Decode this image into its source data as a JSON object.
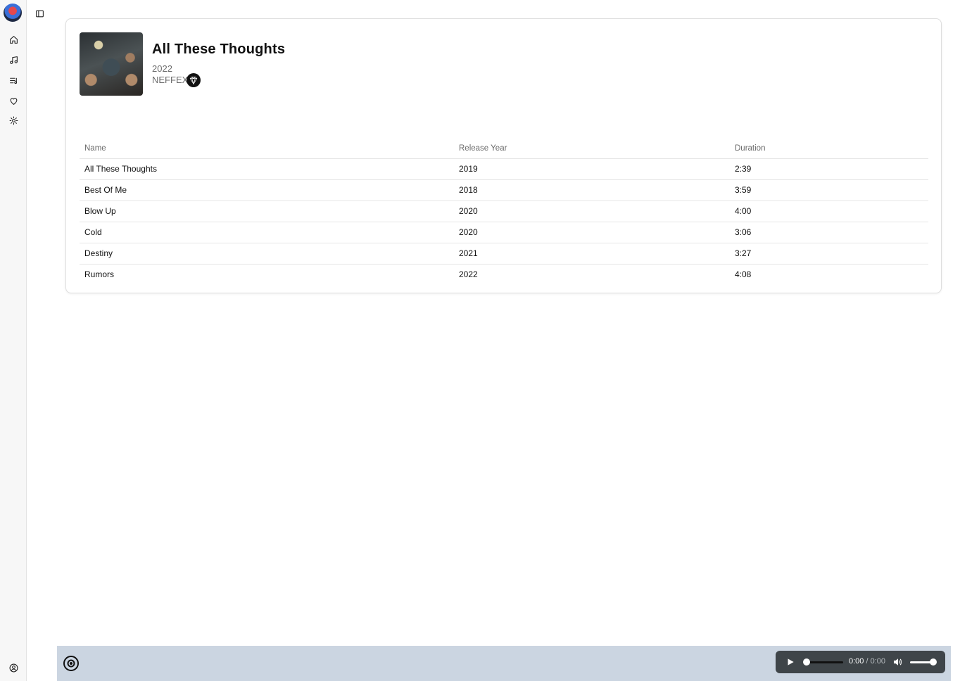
{
  "sidebar": {
    "items": [
      {
        "name": "home",
        "icon": "home-icon"
      },
      {
        "name": "songs",
        "icon": "music-note-icon"
      },
      {
        "name": "playlists",
        "icon": "playlist-icon"
      },
      {
        "name": "favorites",
        "icon": "heart-icon"
      },
      {
        "name": "settings",
        "icon": "gear-icon"
      }
    ],
    "footer_icon": "user-circle-icon"
  },
  "album": {
    "title": "All These Thoughts",
    "year": "2022",
    "artist": "NEFFEX"
  },
  "table": {
    "headers": [
      "Name",
      "Release Year",
      "Duration"
    ],
    "rows": [
      {
        "name": "All These Thoughts",
        "year": "2019",
        "duration": "2:39"
      },
      {
        "name": "Best Of Me",
        "year": "2018",
        "duration": "3:59"
      },
      {
        "name": "Blow Up",
        "year": "2020",
        "duration": "4:00"
      },
      {
        "name": "Cold",
        "year": "2020",
        "duration": "3:06"
      },
      {
        "name": "Destiny",
        "year": "2021",
        "duration": "3:27"
      },
      {
        "name": "Rumors",
        "year": "2022",
        "duration": "4:08"
      }
    ]
  },
  "player": {
    "current_time": "0:00",
    "separator": "/",
    "duration": "0:00",
    "progress": 0,
    "volume": 1,
    "bar_color": "#cbd5e1"
  }
}
